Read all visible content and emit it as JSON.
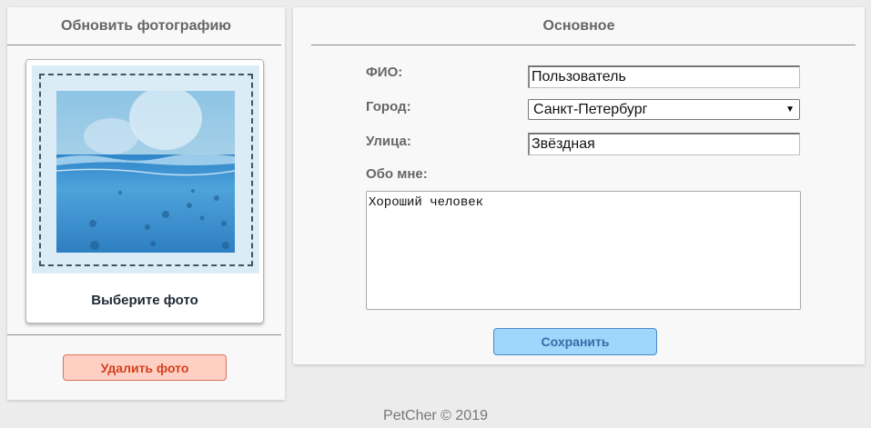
{
  "photo_panel": {
    "title": "Обновить фотографию",
    "choose_caption": "Выберите фото",
    "delete_label": "Удалить фото"
  },
  "main_panel": {
    "title": "Основное",
    "fields": {
      "name": {
        "label": "ФИО:",
        "value": "Пользователь"
      },
      "city": {
        "label": "Город:",
        "value": "Санкт-Петербург"
      },
      "street": {
        "label": "Улица:",
        "value": "Звёздная"
      },
      "about": {
        "label": "Обо мне:",
        "value": "Хороший человек"
      }
    },
    "save_label": "Сохранить"
  },
  "footer": {
    "text": "PetCher © 2019"
  },
  "colors": {
    "delete_bg": "#fdd0c3",
    "delete_text": "#d2401c",
    "save_bg": "#9fd6fb",
    "save_text": "#3a6aa8"
  }
}
